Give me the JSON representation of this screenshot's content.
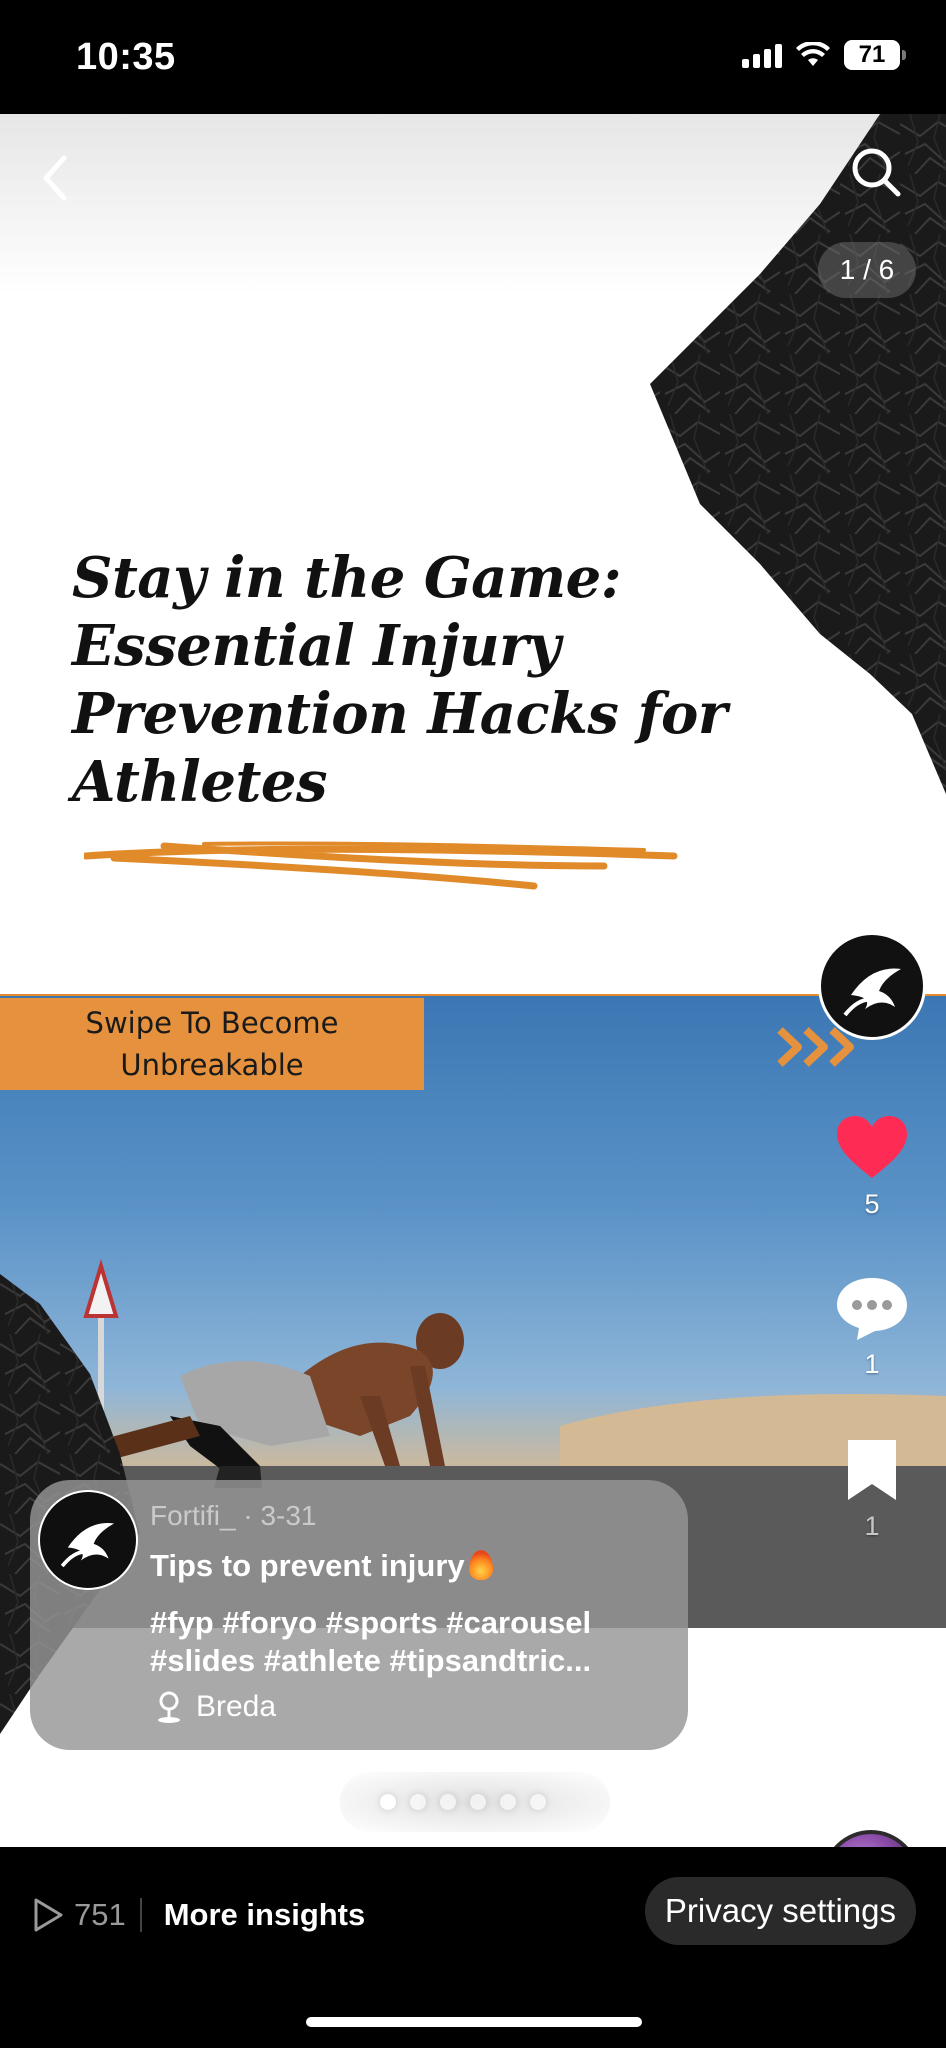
{
  "status_bar": {
    "time": "10:35",
    "battery": "71"
  },
  "slide": {
    "page_counter": "1 / 6",
    "title_lines": [
      "Stay in the Game:",
      "Essential Injury",
      "Prevention Hacks for",
      "Athletes"
    ],
    "swipe_banner_lines": [
      "Swipe To Become",
      "Unbreakable"
    ],
    "accent_color": "#e5913d"
  },
  "actions": {
    "likes": "5",
    "comments": "1",
    "saves": "1",
    "like_color": "#fe2c55"
  },
  "caption": {
    "author": "Fortifi_",
    "date": "· 3-31",
    "title": "Tips to prevent injury",
    "hashtags_line1": "#fyp #foryo #sports #carousel",
    "hashtags_line2": "#slides #athlete #tipsandtric...",
    "location": "Breda"
  },
  "carousel": {
    "count": 6,
    "active": 1
  },
  "bottom_bar": {
    "views": "751",
    "insights_label": "More insights",
    "privacy_label": "Privacy settings"
  },
  "icons": [
    "back-icon",
    "search-icon",
    "heart-icon",
    "comment-icon",
    "bookmark-icon",
    "more-icon",
    "play-icon",
    "location-pin-icon",
    "fire-emoji-icon"
  ]
}
